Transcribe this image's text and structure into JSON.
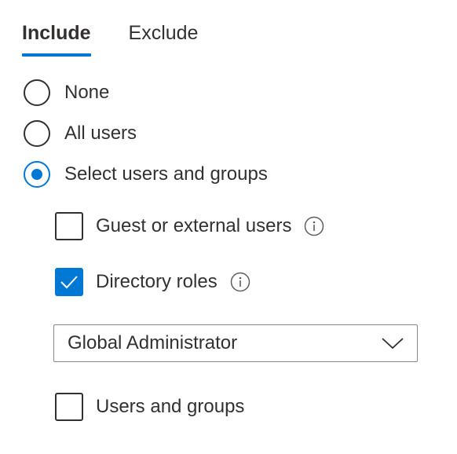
{
  "tabs": [
    {
      "label": "Include",
      "active": true
    },
    {
      "label": "Exclude",
      "active": false
    }
  ],
  "radios": [
    {
      "label": "None",
      "checked": false
    },
    {
      "label": "All users",
      "checked": false
    },
    {
      "label": "Select users and groups",
      "checked": true
    }
  ],
  "options": {
    "guest": {
      "label": "Guest or external users",
      "checked": false,
      "icon": "info-icon"
    },
    "directory_roles": {
      "label": "Directory roles",
      "checked": true,
      "icon": "info-icon"
    },
    "users_groups": {
      "label": "Users and groups",
      "checked": false
    }
  },
  "roles_dropdown": {
    "value": "Global Administrator",
    "icon": "chevron-down-icon"
  },
  "colors": {
    "accent": "#0078d4",
    "text": "#323130",
    "border": "#8a8886"
  }
}
